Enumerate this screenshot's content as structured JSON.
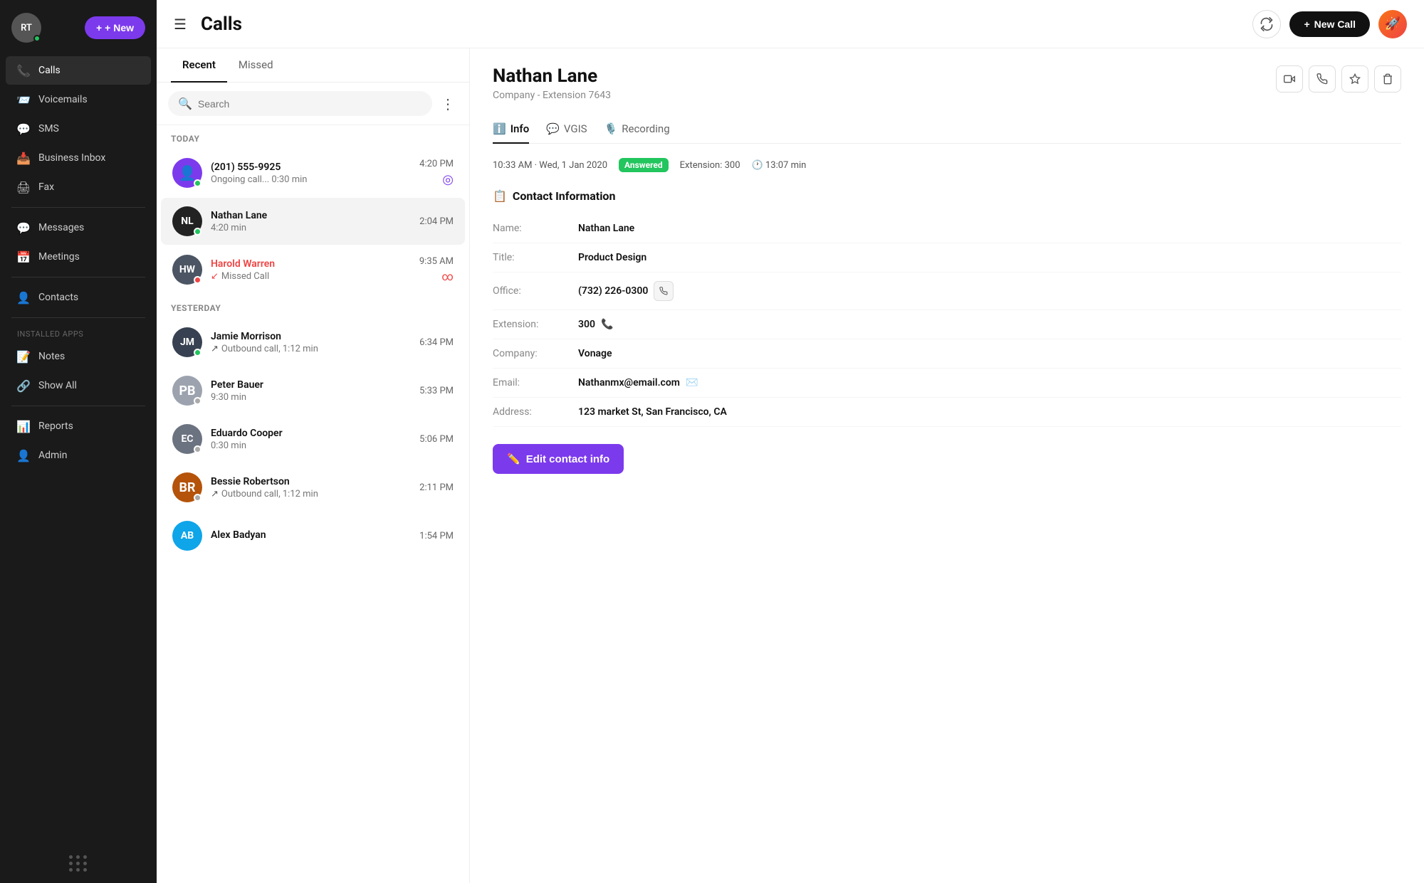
{
  "sidebar": {
    "avatar_initials": "RT",
    "new_button": "+ New",
    "items": [
      {
        "id": "calls",
        "label": "Calls",
        "icon": "📞",
        "active": true
      },
      {
        "id": "voicemails",
        "label": "Voicemails",
        "icon": "📨",
        "active": false
      },
      {
        "id": "sms",
        "label": "SMS",
        "icon": "💬",
        "active": false
      },
      {
        "id": "business-inbox",
        "label": "Business Inbox",
        "icon": "📥",
        "active": false
      },
      {
        "id": "fax",
        "label": "Fax",
        "icon": "🖨",
        "active": false
      }
    ],
    "items2": [
      {
        "id": "messages",
        "label": "Messages",
        "icon": "💬"
      },
      {
        "id": "meetings",
        "label": "Meetings",
        "icon": "📅"
      }
    ],
    "items3": [
      {
        "id": "contacts",
        "label": "Contacts",
        "icon": "👤"
      }
    ],
    "installed_apps_label": "INSTALLED APPS",
    "installed_apps": [
      {
        "id": "notes",
        "label": "Notes",
        "icon": "📝"
      },
      {
        "id": "show-all",
        "label": "Show All",
        "icon": "🔗"
      }
    ],
    "bottom_items": [
      {
        "id": "reports",
        "label": "Reports",
        "icon": "📊"
      },
      {
        "id": "admin",
        "label": "Admin",
        "icon": "👤"
      }
    ]
  },
  "topbar": {
    "title": "Calls",
    "new_call_label": "New Call"
  },
  "calls_panel": {
    "tabs": [
      {
        "id": "recent",
        "label": "Recent",
        "active": true
      },
      {
        "id": "missed",
        "label": "Missed",
        "active": false
      }
    ],
    "search_placeholder": "Search",
    "section_today": "TODAY",
    "section_yesterday": "YESTERDAY",
    "calls": [
      {
        "id": "c1",
        "name": "(201) 555-9925",
        "sub": "Ongoing call... 0:30 min",
        "time": "4:20 PM",
        "bg": "#7c3aed",
        "initials": "",
        "is_ongoing": true,
        "status": "green",
        "section": "today"
      },
      {
        "id": "c2",
        "name": "Nathan Lane",
        "sub": "4:20 min",
        "time": "2:04 PM",
        "bg": "#222",
        "initials": "NL",
        "selected": true,
        "status": "green",
        "section": "today"
      },
      {
        "id": "c3",
        "name": "Harold Warren",
        "sub": "Missed Call",
        "time": "9:35 AM",
        "bg": "#4b5563",
        "initials": "HW",
        "missed": true,
        "has_voicemail": true,
        "status": "red",
        "section": "today"
      },
      {
        "id": "c4",
        "name": "Jamie Morrison",
        "sub": "Outbound call, 1:12 min",
        "time": "6:34 PM",
        "bg": "#374151",
        "initials": "JM",
        "outbound": true,
        "status": "green",
        "section": "yesterday"
      },
      {
        "id": "c5",
        "name": "Peter Bauer",
        "sub": "9:30 min",
        "time": "5:33 PM",
        "bg": "#d1d5db",
        "initials": "PB",
        "is_photo": true,
        "status": "gray",
        "section": "yesterday"
      },
      {
        "id": "c6",
        "name": "Eduardo Cooper",
        "sub": "0:30 min",
        "time": "5:06 PM",
        "bg": "#6b7280",
        "initials": "EC",
        "status": "gray",
        "section": "yesterday"
      },
      {
        "id": "c7",
        "name": "Bessie Robertson",
        "sub": "Outbound call, 1:12 min",
        "time": "2:11 PM",
        "bg": "#d1d5db",
        "initials": "BR",
        "is_photo": true,
        "outbound": true,
        "section": "yesterday"
      },
      {
        "id": "c8",
        "name": "Alex Badyan",
        "sub": "",
        "time": "1:54 PM",
        "bg": "#0ea5e9",
        "initials": "AB",
        "is_photo": true,
        "section": "yesterday"
      }
    ]
  },
  "detail": {
    "name": "Nathan Lane",
    "subtitle": "Company  -  Extension 7643",
    "tabs": [
      {
        "id": "info",
        "label": "Info",
        "active": true,
        "icon": "ℹ"
      },
      {
        "id": "vgis",
        "label": "VGIS",
        "active": false,
        "icon": "💬"
      },
      {
        "id": "recording",
        "label": "Recording",
        "active": false,
        "icon": "🎙"
      }
    ],
    "call_time": "10:33 AM  ·  Wed, 1 Jan 2020",
    "answered_badge": "Answered",
    "extension_label": "Extension:",
    "extension_value": "300",
    "duration_label": "13:07 min",
    "contact_info_header": "Contact Information",
    "fields": [
      {
        "label": "Name:",
        "value": "Nathan Lane",
        "has_phone": false,
        "has_email": false
      },
      {
        "label": "Title:",
        "value": "Product  Design",
        "has_phone": false,
        "has_email": false
      },
      {
        "label": "Office:",
        "value": "(732) 226-0300",
        "has_phone": true,
        "has_email": false
      },
      {
        "label": "Extension:",
        "value": "300",
        "has_phone": true,
        "has_email": false,
        "ext_phone": true
      },
      {
        "label": "Company:",
        "value": "Vonage",
        "has_phone": false,
        "has_email": false
      },
      {
        "label": "Email:",
        "value": "Nathanmx@email.com",
        "has_phone": false,
        "has_email": true
      },
      {
        "label": "Address:",
        "value": "123 market St, San Francisco, CA",
        "has_phone": false,
        "has_email": false
      }
    ],
    "edit_contact_label": "Edit contact info"
  }
}
